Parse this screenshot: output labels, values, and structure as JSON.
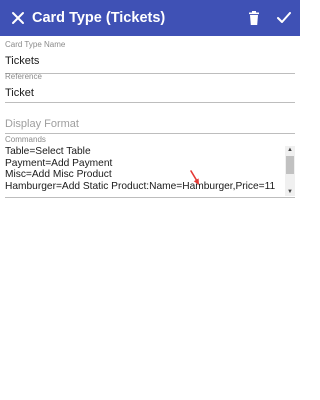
{
  "appbar": {
    "title": "Card Type (Tickets)",
    "close_icon": "close-icon",
    "delete_icon": "trash-icon",
    "save_icon": "check-icon",
    "color": "#3f51b5"
  },
  "fields": {
    "card_type_name": {
      "label": "Card Type Name",
      "value": "Tickets"
    },
    "reference": {
      "label": "Reference",
      "value": "Ticket"
    },
    "display_format": {
      "placeholder": "Display Format"
    },
    "commands": {
      "label": "Commands",
      "lines": [
        "Table=Select Table",
        "Payment=Add Payment",
        "Misc=Add Misc Product",
        "Hamburger=Add Static Product:Name=Hamburger,Price=11"
      ]
    }
  },
  "annotation": {
    "marker_icon": "red-arrow-icon",
    "color": "#e53935"
  }
}
